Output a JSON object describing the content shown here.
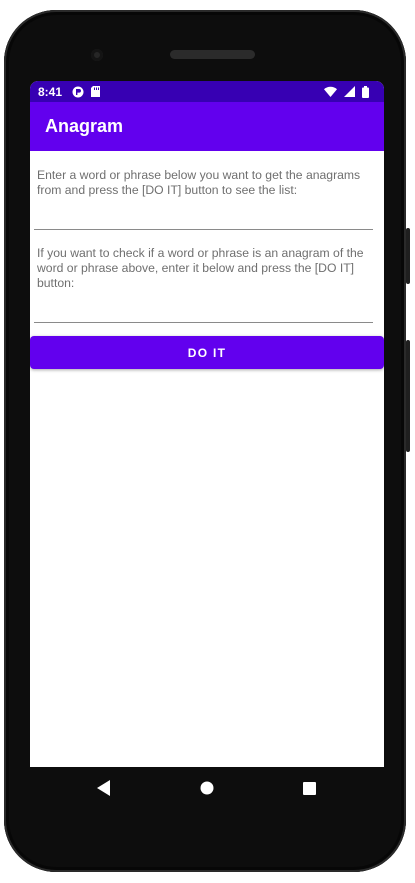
{
  "status_bar": {
    "time": "8:41",
    "left_icons": [
      "notification-app-icon",
      "sd-card-icon"
    ],
    "right_icons": [
      "wifi-icon",
      "signal-icon",
      "battery-icon"
    ]
  },
  "app_bar": {
    "title": "Anagram"
  },
  "form": {
    "instruction_1": "Enter a word or phrase below you want to get the anagrams from and press the [DO IT] button to see the list:",
    "input_1": {
      "value": "",
      "placeholder": ""
    },
    "instruction_2": "If you want to check if a word or phrase is an anagram of the word or phrase above, enter it below and press the [DO IT] button:",
    "input_2": {
      "value": "",
      "placeholder": ""
    },
    "button_label": "DO IT"
  },
  "nav_bar": {
    "buttons": [
      "back-icon",
      "home-icon",
      "recents-icon"
    ]
  },
  "colors": {
    "status_bar": "#3700b3",
    "primary": "#6200ee",
    "text_secondary": "#6f6f6f",
    "on_primary": "#ffffff"
  }
}
